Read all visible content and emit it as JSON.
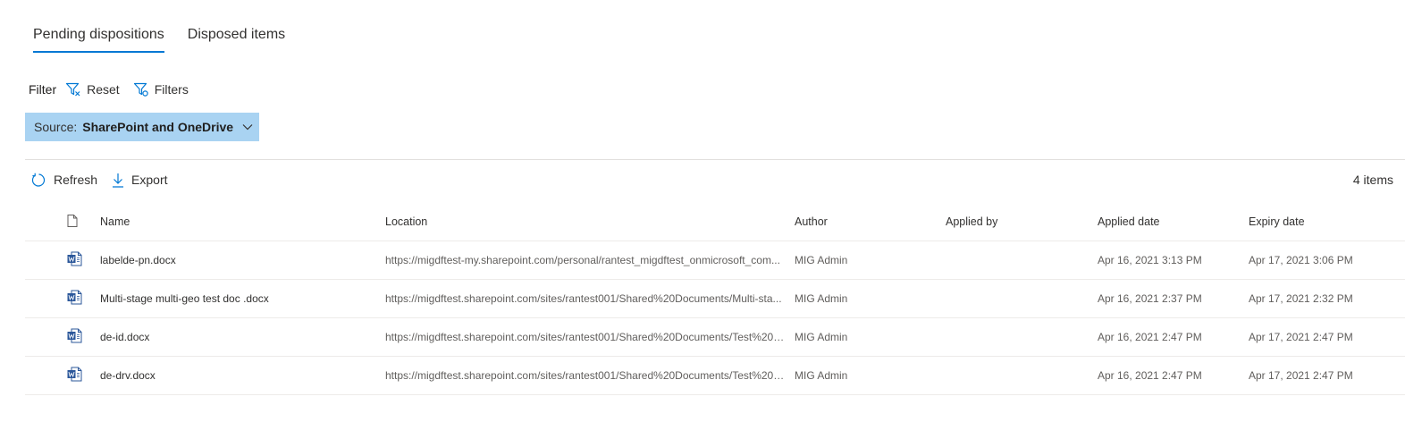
{
  "tabs": [
    {
      "label": "Pending dispositions",
      "active": true
    },
    {
      "label": "Disposed items",
      "active": false
    }
  ],
  "filter": {
    "label": "Filter",
    "reset_label": "Reset",
    "filters_label": "Filters"
  },
  "source": {
    "label": "Source:",
    "value": "SharePoint and OneDrive"
  },
  "commands": {
    "refresh_label": "Refresh",
    "export_label": "Export",
    "item_count": "4 items"
  },
  "table": {
    "headers": {
      "name": "Name",
      "location": "Location",
      "author": "Author",
      "applied_by": "Applied by",
      "applied_date": "Applied date",
      "expiry_date": "Expiry date"
    },
    "rows": [
      {
        "name": "labelde-pn.docx",
        "location": "https://migdftest-my.sharepoint.com/personal/rantest_migdftest_onmicrosoft_com...",
        "author": "MIG Admin",
        "applied_by": "",
        "applied_date": "Apr 16, 2021 3:13 PM",
        "expiry_date": "Apr 17, 2021 3:06 PM"
      },
      {
        "name": "Multi-stage multi-geo test doc .docx",
        "location": "https://migdftest.sharepoint.com/sites/rantest001/Shared%20Documents/Multi-sta...",
        "author": "MIG Admin",
        "applied_by": "",
        "applied_date": "Apr 16, 2021 2:37 PM",
        "expiry_date": "Apr 17, 2021 2:32 PM"
      },
      {
        "name": "de-id.docx",
        "location": "https://migdftest.sharepoint.com/sites/rantest001/Shared%20Documents/Test%201...",
        "author": "MIG Admin",
        "applied_by": "",
        "applied_date": "Apr 16, 2021 2:47 PM",
        "expiry_date": "Apr 17, 2021 2:47 PM"
      },
      {
        "name": "de-drv.docx",
        "location": "https://migdftest.sharepoint.com/sites/rantest001/Shared%20Documents/Test%201...",
        "author": "MIG Admin",
        "applied_by": "",
        "applied_date": "Apr 16, 2021 2:47 PM",
        "expiry_date": "Apr 17, 2021 2:47 PM"
      }
    ]
  },
  "icons": {
    "reset": "filter-clear-icon",
    "filters": "filter-settings-icon",
    "refresh": "refresh-icon",
    "export": "download-icon",
    "file_header": "document-icon",
    "row_file": "word-document-icon"
  },
  "colors": {
    "accent": "#0078d4",
    "source_pill": "#a9d3f2",
    "word_icon": "#2b579a"
  }
}
